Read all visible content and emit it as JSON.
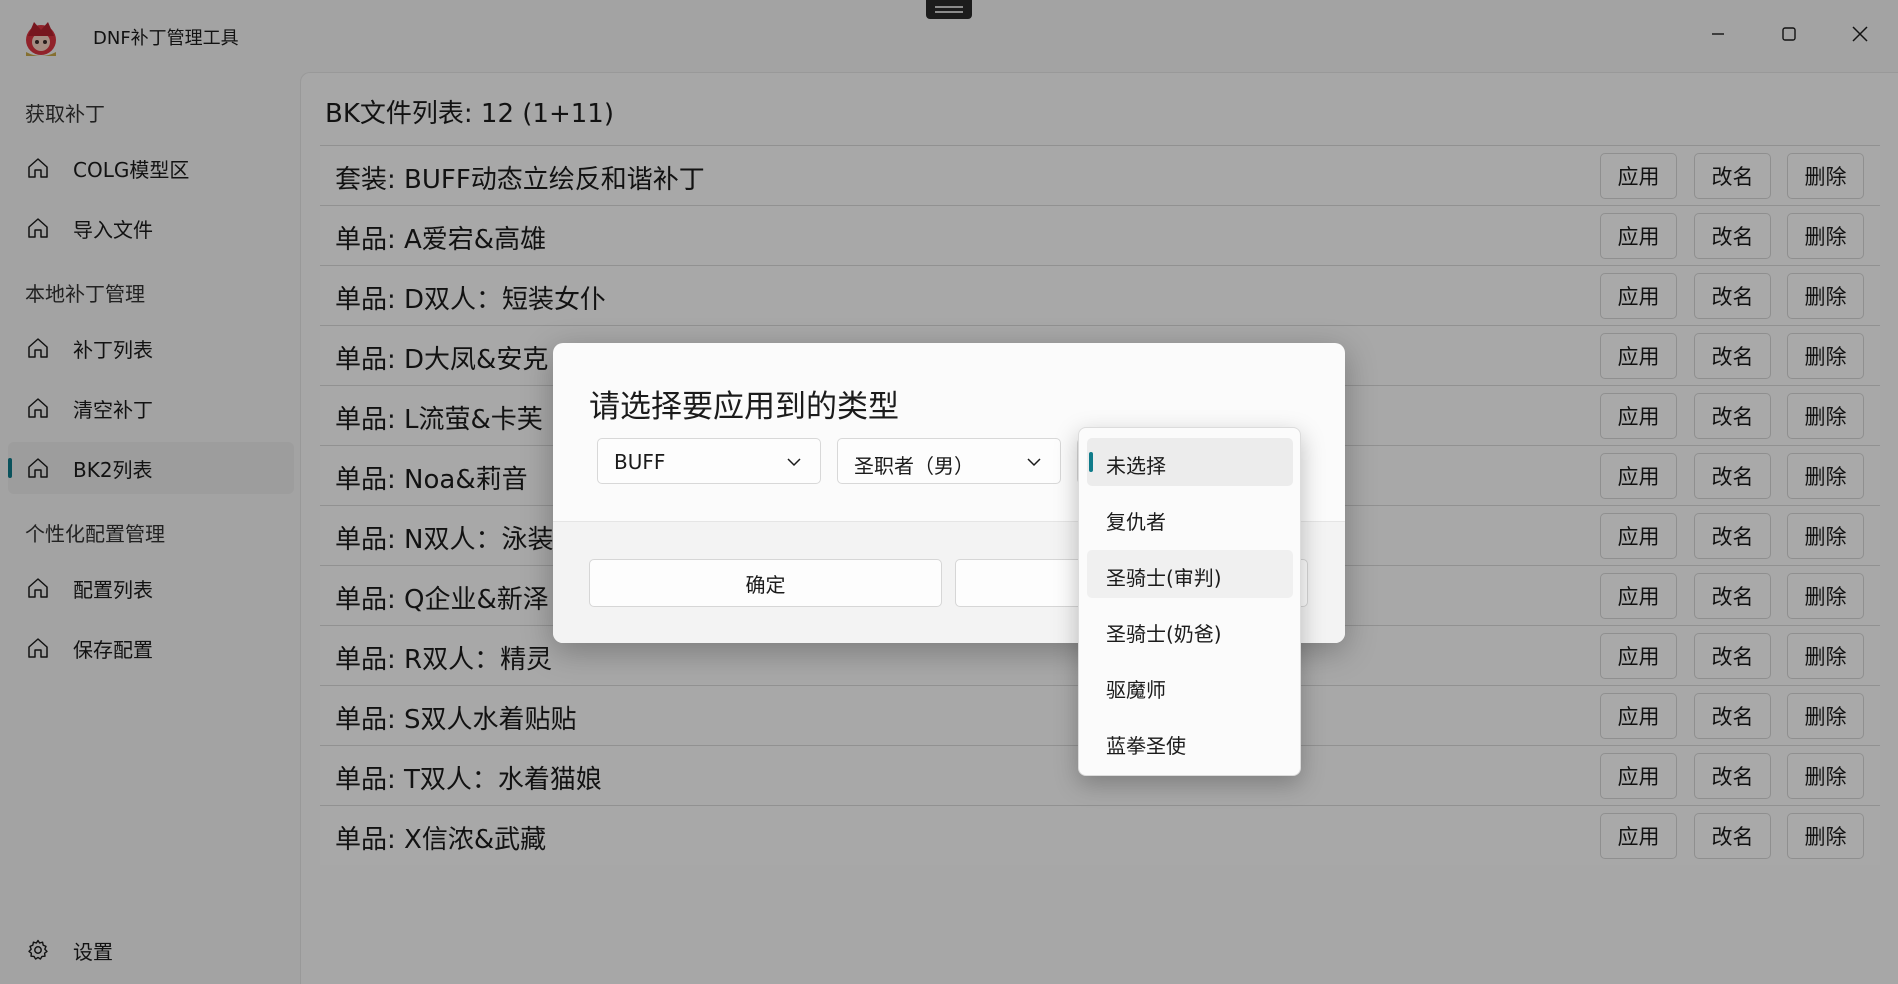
{
  "app": {
    "title": "DNF补丁管理工具",
    "accent": "#0f7b8a"
  },
  "window_controls": {
    "minimize_icon": "minimize-icon",
    "maximize_icon": "maximize-icon",
    "close_icon": "close-icon"
  },
  "sidebar": {
    "sections": [
      {
        "title": "获取补丁",
        "items": [
          {
            "label": "COLG模型区",
            "icon": "home-icon"
          },
          {
            "label": "导入文件",
            "icon": "home-icon"
          }
        ]
      },
      {
        "title": "本地补丁管理",
        "items": [
          {
            "label": "补丁列表",
            "icon": "home-icon"
          },
          {
            "label": "清空补丁",
            "icon": "home-icon"
          },
          {
            "label": "BK2列表",
            "icon": "home-icon",
            "active": true
          }
        ]
      },
      {
        "title": "个性化配置管理",
        "items": [
          {
            "label": "配置列表",
            "icon": "home-icon"
          },
          {
            "label": "保存配置",
            "icon": "home-icon"
          }
        ]
      }
    ],
    "settings": {
      "label": "设置",
      "icon": "gear-icon"
    }
  },
  "main": {
    "title": "BK文件列表: 12 (1+11)",
    "actions": {
      "apply": "应用",
      "rename": "改名",
      "delete": "删除"
    },
    "rows": [
      "套装: BUFF动态立绘反和谐补丁",
      "单品: A爱宕&高雄",
      "单品: D双人：短装女仆",
      "单品: D大凤&安克",
      "单品: L流萤&卡芙",
      "单品: Noa&莉音",
      "单品: N双人：泳装",
      "单品: Q企业&新泽",
      "单品: R双人：精灵",
      "单品: S双人水着贴贴",
      "单品: T双人：水着猫娘",
      "单品: X信浓&武藏"
    ]
  },
  "dialog": {
    "title": "请选择要应用到的类型",
    "combo1": {
      "value": "BUFF"
    },
    "combo2": {
      "value": "圣职者（男）"
    },
    "confirm": "确定",
    "cancel": ""
  },
  "dropdown": {
    "options": [
      "未选择",
      "复仇者",
      "圣骑士(审判)",
      "圣骑士(奶爸)",
      "驱魔师",
      "蓝拳圣使"
    ],
    "selected": "未选择",
    "hovered": "圣骑士(审判)"
  }
}
